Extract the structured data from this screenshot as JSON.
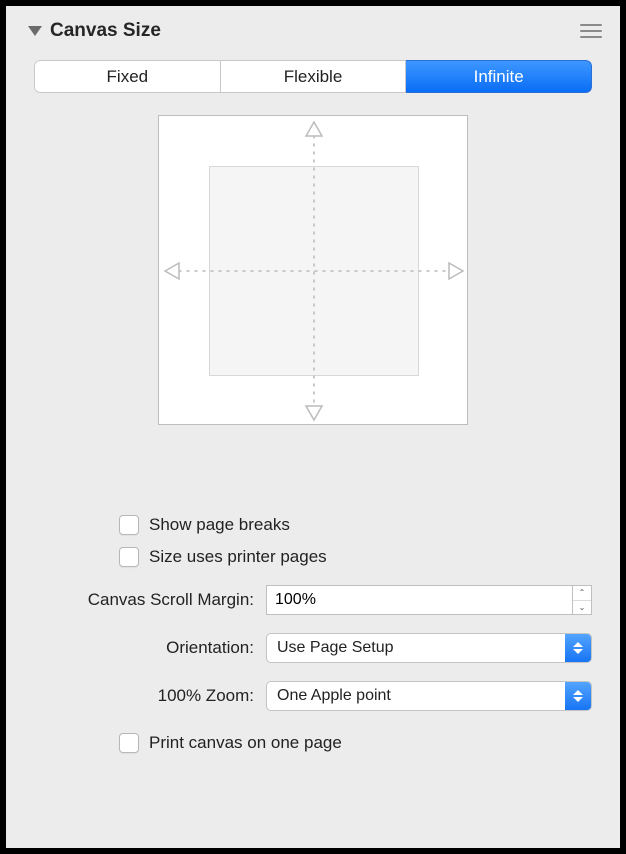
{
  "header": {
    "title": "Canvas Size"
  },
  "tabs": {
    "items": [
      "Fixed",
      "Flexible",
      "Infinite"
    ],
    "selected_index": 2
  },
  "options": {
    "show_page_breaks": {
      "label": "Show page breaks",
      "checked": false
    },
    "size_uses_printer_pages": {
      "label": "Size uses printer pages",
      "checked": false
    },
    "print_one_page": {
      "label": "Print canvas on one page",
      "checked": false
    }
  },
  "fields": {
    "scroll_margin": {
      "label": "Canvas Scroll Margin:",
      "value": "100%"
    },
    "orientation": {
      "label": "Orientation:",
      "value": "Use Page Setup"
    },
    "zoom": {
      "label": "100% Zoom:",
      "value": "One Apple point"
    }
  }
}
